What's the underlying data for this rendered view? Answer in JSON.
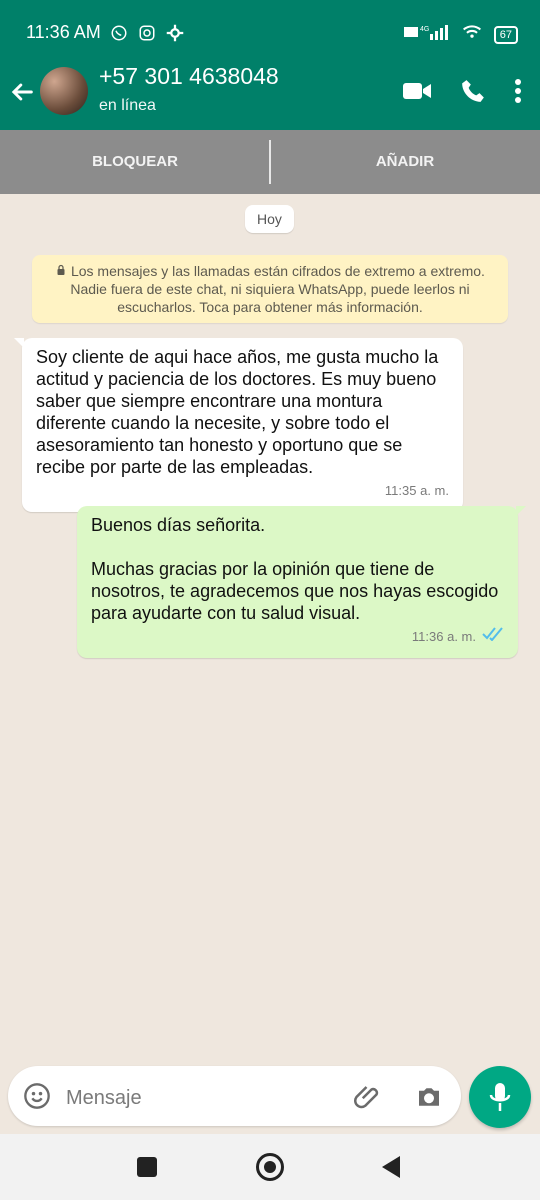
{
  "status_bar": {
    "time": "11:36 AM",
    "battery": "67",
    "network": "4G"
  },
  "header": {
    "title": "+57 301 4638048",
    "subtitle": "en línea"
  },
  "actions": {
    "block": "BLOQUEAR",
    "add": "AÑADIR"
  },
  "chat": {
    "date_divider": "Hoy",
    "encryption_notice": "Los mensajes y las llamadas están cifrados de extremo a extremo. Nadie fuera de este chat, ni siquiera WhatsApp, puede leerlos ni escucharlos. Toca para obtener más información.",
    "messages": [
      {
        "direction": "incoming",
        "text": "Soy cliente de aqui  hace años, me gusta mucho la actitud y paciencia de los doctores.  Es muy bueno saber que siempre encontrare una montura diferente cuando la necesite, y sobre todo el asesoramiento tan honesto y oportuno que se recibe por parte de las empleadas.",
        "time": "11:35 a. m."
      },
      {
        "direction": "outgoing",
        "line1": "Buenos días señorita.",
        "line2": "Muchas gracias por la opinión que tiene de nosotros, te agradecemos que nos hayas escogido para ayudarte con tu salud visual.",
        "time": "11:36 a. m."
      }
    ]
  },
  "composer": {
    "placeholder": "Mensaje"
  },
  "colors": {
    "header": "#008069",
    "fab": "#00a884",
    "outgoing_bubble": "#dcf8c6",
    "notice_bg": "#fff3c4",
    "action_bar": "#8c8c8c"
  },
  "icons": [
    "whatsapp-icon",
    "instagram-icon",
    "settings-icon",
    "signal-icon",
    "wifi-icon",
    "battery-icon",
    "back-arrow-icon",
    "video-call-icon",
    "phone-call-icon",
    "more-vert-icon",
    "lock-icon",
    "double-check-icon",
    "emoji-icon",
    "attach-icon",
    "camera-icon",
    "mic-icon",
    "recent-apps-icon",
    "home-icon",
    "back-nav-icon"
  ]
}
